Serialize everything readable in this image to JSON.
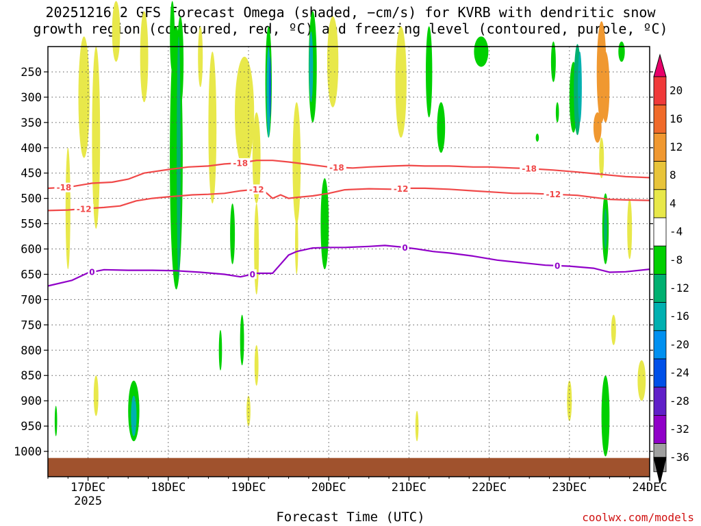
{
  "title_line1": "2025121612 GFS Forecast Omega (shaded, −cm/s) for KVRB with dendritic snow",
  "title_line2": "growth region (contoured, red, ºC) and freezing level (contoured, purple, ºC)",
  "credit": "coolwx.com/models",
  "colors": {
    "dgz": "#f04848",
    "freezing": "#9000c8",
    "ground": "#a0522d",
    "frame": "#000000",
    "grid": "#555555"
  },
  "chart_data": {
    "type": "heatmap",
    "xlabel": "Forecast Time (UTC)",
    "ylabel": "",
    "x_ticks": [
      {
        "value": 0.5,
        "label": "17DEC",
        "sublabel": "2025"
      },
      {
        "value": 1.5,
        "label": "18DEC",
        "sublabel": ""
      },
      {
        "value": 2.5,
        "label": "19DEC",
        "sublabel": ""
      },
      {
        "value": 3.5,
        "label": "20DEC",
        "sublabel": ""
      },
      {
        "value": 4.5,
        "label": "21DEC",
        "sublabel": ""
      },
      {
        "value": 5.5,
        "label": "22DEC",
        "sublabel": ""
      },
      {
        "value": 6.5,
        "label": "23DEC",
        "sublabel": ""
      },
      {
        "value": 7.5,
        "label": "24DEC",
        "sublabel": ""
      }
    ],
    "xlim": [
      0,
      7.5
    ],
    "ylim": [
      1050,
      200
    ],
    "y_ticks": [
      250,
      300,
      350,
      400,
      450,
      500,
      550,
      600,
      650,
      700,
      750,
      800,
      850,
      900,
      950,
      1000
    ],
    "grid": true,
    "colorbar": {
      "labels": [
        20,
        16,
        12,
        8,
        4,
        -4,
        -8,
        -12,
        -16,
        -20,
        -24,
        -28,
        -32,
        -36
      ],
      "colors": [
        "#e8006a",
        "#f03a3a",
        "#f06a2a",
        "#f09830",
        "#e8c43a",
        "#e8e84a",
        "#ffffff",
        "#00d000",
        "#00b070",
        "#00b0b0",
        "#0090f0",
        "#0050e8",
        "#6020c8",
        "#9000c8",
        "#a0a0a0",
        "#000000"
      ]
    },
    "contour_dgz_minus18": {
      "x": [
        0,
        0.25,
        0.4,
        0.55,
        0.8,
        1.0,
        1.2,
        1.5,
        1.75,
        2.0,
        2.2,
        2.4,
        2.6,
        2.8,
        3.0,
        3.2,
        3.5,
        3.8,
        4.0,
        4.3,
        4.5,
        4.7,
        5.0,
        5.3,
        5.5,
        5.8,
        6.0,
        6.3,
        6.6,
        6.8,
        7.0,
        7.2,
        7.5
      ],
      "y": [
        480,
        478,
        474,
        470,
        468,
        462,
        450,
        443,
        438,
        436,
        432,
        430,
        425,
        425,
        428,
        432,
        438,
        440,
        438,
        436,
        435,
        436,
        436,
        438,
        438,
        440,
        441,
        444,
        448,
        451,
        454,
        457,
        459
      ],
      "labels": [
        {
          "x": 0.2,
          "text": "-18"
        },
        {
          "x": 2.4,
          "text": "-18"
        },
        {
          "x": 3.6,
          "text": "-18"
        },
        {
          "x": 6.0,
          "text": "-18"
        }
      ]
    },
    "contour_dgz_minus12": {
      "x": [
        0,
        0.25,
        0.5,
        0.7,
        0.9,
        1.1,
        1.3,
        1.5,
        1.8,
        2.0,
        2.2,
        2.4,
        2.6,
        2.7,
        2.8,
        2.9,
        3.0,
        3.1,
        3.3,
        3.5,
        3.7,
        4.0,
        4.3,
        4.5,
        4.7,
        5.0,
        5.3,
        5.6,
        5.8,
        6.0,
        6.3,
        6.6,
        6.8,
        7.0,
        7.2,
        7.5
      ],
      "y": [
        524,
        523,
        520,
        518,
        515,
        505,
        500,
        497,
        493,
        492,
        490,
        485,
        482,
        486,
        500,
        493,
        500,
        498,
        495,
        490,
        483,
        481,
        482,
        480,
        480,
        482,
        485,
        488,
        490,
        490,
        492,
        494,
        498,
        502,
        503,
        504
      ],
      "labels": [
        {
          "x": 0.45,
          "text": "-12"
        },
        {
          "x": 2.6,
          "text": "-12"
        },
        {
          "x": 4.4,
          "text": "-12"
        },
        {
          "x": 6.3,
          "text": "-12"
        }
      ]
    },
    "contour_freezing_0": {
      "x": [
        0,
        0.3,
        0.5,
        0.7,
        1.0,
        1.3,
        1.6,
        1.9,
        2.2,
        2.4,
        2.6,
        2.8,
        2.9,
        3.0,
        3.1,
        3.3,
        3.5,
        3.7,
        4.0,
        4.2,
        4.4,
        4.6,
        4.8,
        5.0,
        5.3,
        5.6,
        5.9,
        6.2,
        6.5,
        6.8,
        7.0,
        7.2,
        7.5
      ],
      "y": [
        673,
        662,
        647,
        641,
        642,
        642,
        643,
        646,
        650,
        655,
        648,
        648,
        630,
        612,
        605,
        598,
        597,
        597,
        595,
        593,
        596,
        600,
        605,
        608,
        614,
        622,
        627,
        632,
        634,
        638,
        646,
        645,
        640
      ],
      "labels": [
        {
          "x": 0.55,
          "text": "0"
        },
        {
          "x": 2.55,
          "text": "0"
        },
        {
          "x": 4.45,
          "text": "0"
        },
        {
          "x": 6.35,
          "text": "0"
        }
      ]
    }
  }
}
